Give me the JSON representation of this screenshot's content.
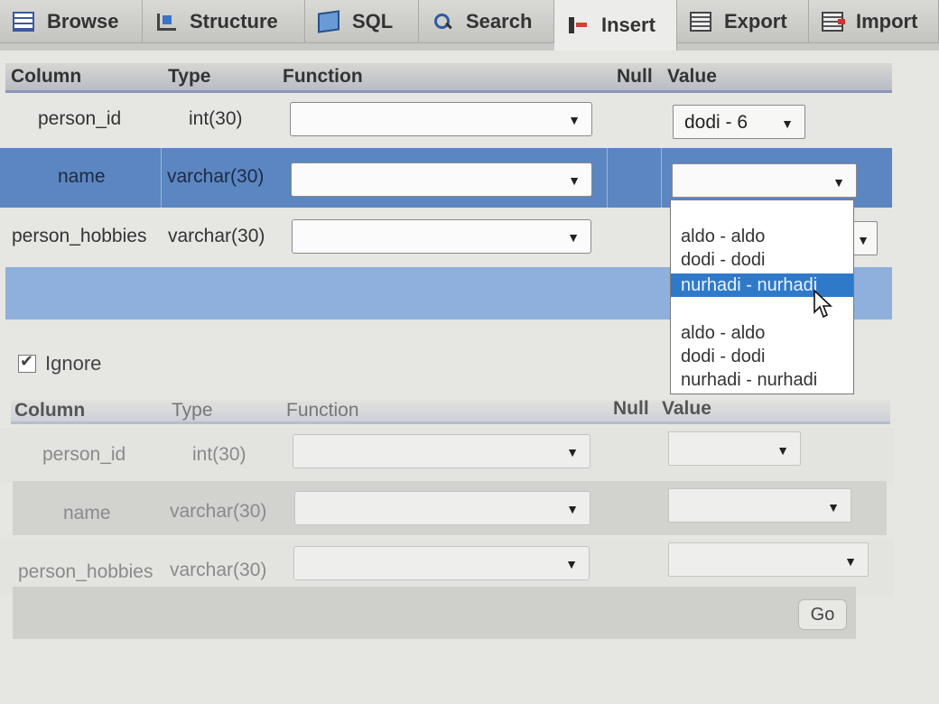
{
  "tabs": [
    {
      "label": "Browse",
      "icon": "grid-icon"
    },
    {
      "label": "Structure",
      "icon": "structure-icon"
    },
    {
      "label": "SQL",
      "icon": "sql-icon"
    },
    {
      "label": "Search",
      "icon": "search-icon"
    },
    {
      "label": "Insert",
      "icon": "insert-icon",
      "active": true
    },
    {
      "label": "Export",
      "icon": "export-icon"
    },
    {
      "label": "Import",
      "icon": "import-icon"
    }
  ],
  "headers": {
    "column": "Column",
    "type": "Type",
    "function": "Function",
    "null": "Null",
    "value": "Value"
  },
  "form1": {
    "rows": [
      {
        "column": "person_id",
        "type": "int(30)",
        "value": "dodi - 6"
      },
      {
        "column": "name",
        "type": "varchar(30)",
        "value": ""
      },
      {
        "column": "person_hobbies",
        "type": "varchar(30)",
        "value": ""
      }
    ],
    "dropdown_options": [
      "aldo - aldo",
      "dodi - dodi",
      "nurhadi - nurhadi",
      "",
      "aldo - aldo",
      "dodi - dodi",
      "nurhadi - nurhadi"
    ],
    "highlighted_option": "nurhadi - nurhadi"
  },
  "ignore_label": "Ignore",
  "form2": {
    "rows": [
      {
        "column": "person_id",
        "type": "int(30)"
      },
      {
        "column": "name",
        "type": "varchar(30)"
      },
      {
        "column": "person_hobbies",
        "type": "varchar(30)"
      }
    ]
  },
  "go_label": "Go",
  "colors": {
    "accent": "#5b86c1",
    "highlight": "#2f7ac8",
    "header_border": "#8c97b8"
  }
}
